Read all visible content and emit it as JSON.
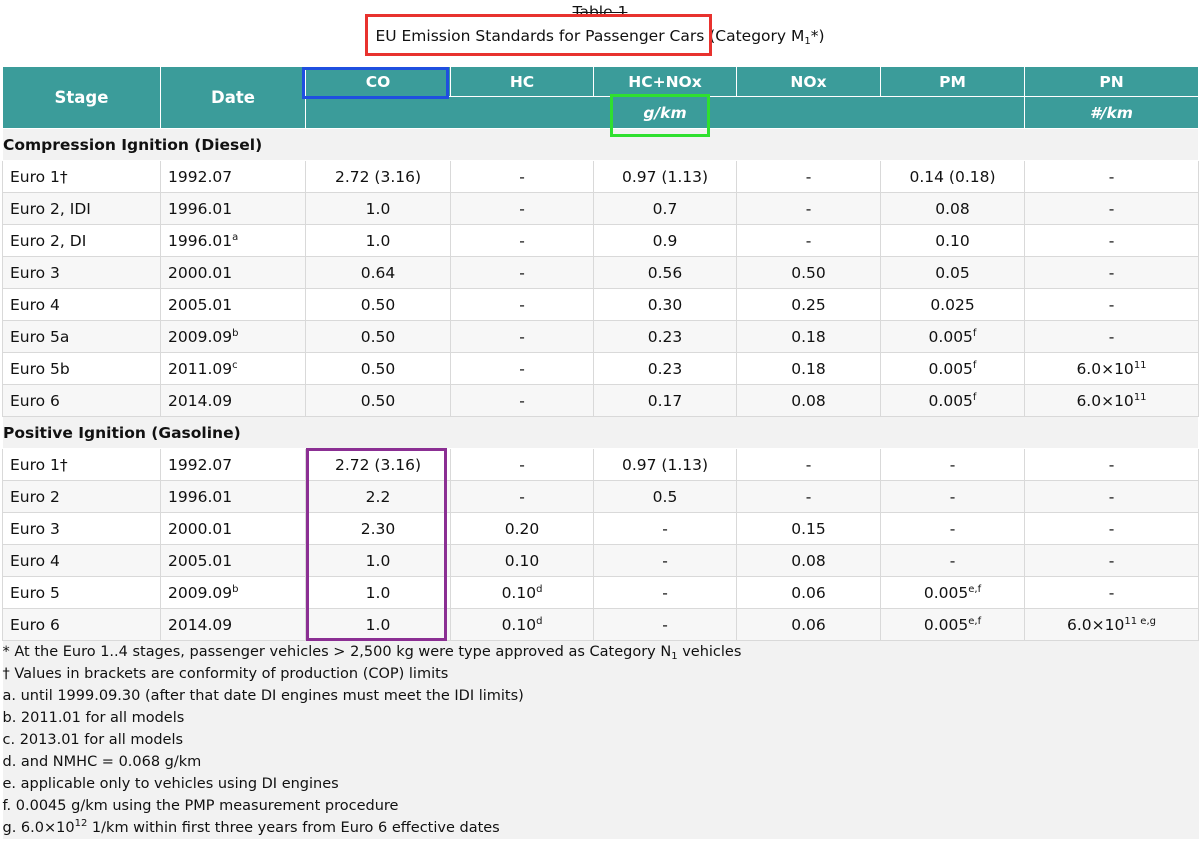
{
  "caption": {
    "label": "Table 1",
    "title_main": "EU Emission Standards for Passenger Cars",
    "title_pre_sub": " (Category M",
    "title_sub": "1",
    "title_post": "*)"
  },
  "headers": {
    "stage": "Stage",
    "date": "Date",
    "co": "CO",
    "hc": "HC",
    "hcnox": "HC+NOx",
    "nox": "NOx",
    "pm": "PM",
    "pn": "PN",
    "unit_gkm": "g/km",
    "unit_numkm": "#/km"
  },
  "sections": [
    {
      "title": "Compression Ignition (Diesel)",
      "rows": [
        [
          [
            "Euro 1†"
          ],
          [
            "1992.07"
          ],
          [
            "2.72 (3.16)"
          ],
          [
            "-"
          ],
          [
            "0.97 (1.13)"
          ],
          [
            "-"
          ],
          [
            "0.14 (0.18)"
          ],
          [
            "-"
          ]
        ],
        [
          [
            "Euro 2, IDI"
          ],
          [
            "1996.01"
          ],
          [
            "1.0"
          ],
          [
            "-"
          ],
          [
            "0.7"
          ],
          [
            "-"
          ],
          [
            "0.08"
          ],
          [
            "-"
          ]
        ],
        [
          [
            "Euro 2, DI"
          ],
          [
            "1996.01",
            "a"
          ],
          [
            "1.0"
          ],
          [
            "-"
          ],
          [
            "0.9"
          ],
          [
            "-"
          ],
          [
            "0.10"
          ],
          [
            "-"
          ]
        ],
        [
          [
            "Euro 3"
          ],
          [
            "2000.01"
          ],
          [
            "0.64"
          ],
          [
            "-"
          ],
          [
            "0.56"
          ],
          [
            "0.50"
          ],
          [
            "0.05"
          ],
          [
            "-"
          ]
        ],
        [
          [
            "Euro 4"
          ],
          [
            "2005.01"
          ],
          [
            "0.50"
          ],
          [
            "-"
          ],
          [
            "0.30"
          ],
          [
            "0.25"
          ],
          [
            "0.025"
          ],
          [
            "-"
          ]
        ],
        [
          [
            "Euro 5a"
          ],
          [
            "2009.09",
            "b"
          ],
          [
            "0.50"
          ],
          [
            "-"
          ],
          [
            "0.23"
          ],
          [
            "0.18"
          ],
          [
            "0.005",
            "f"
          ],
          [
            "-"
          ]
        ],
        [
          [
            "Euro 5b"
          ],
          [
            "2011.09",
            "c"
          ],
          [
            "0.50"
          ],
          [
            "-"
          ],
          [
            "0.23"
          ],
          [
            "0.18"
          ],
          [
            "0.005",
            "f"
          ],
          [
            "6.0×10",
            "11"
          ]
        ],
        [
          [
            "Euro 6"
          ],
          [
            "2014.09"
          ],
          [
            "0.50"
          ],
          [
            "-"
          ],
          [
            "0.17"
          ],
          [
            "0.08"
          ],
          [
            "0.005",
            "f"
          ],
          [
            "6.0×10",
            "11"
          ]
        ]
      ]
    },
    {
      "title": "Positive Ignition (Gasoline)",
      "rows": [
        [
          [
            "Euro 1†"
          ],
          [
            "1992.07"
          ],
          [
            "2.72 (3.16)"
          ],
          [
            "-"
          ],
          [
            "0.97 (1.13)"
          ],
          [
            "-"
          ],
          [
            "-"
          ],
          [
            "-"
          ]
        ],
        [
          [
            "Euro 2"
          ],
          [
            "1996.01"
          ],
          [
            "2.2"
          ],
          [
            "-"
          ],
          [
            "0.5"
          ],
          [
            "-"
          ],
          [
            "-"
          ],
          [
            "-"
          ]
        ],
        [
          [
            "Euro 3"
          ],
          [
            "2000.01"
          ],
          [
            "2.30"
          ],
          [
            "0.20"
          ],
          [
            "-"
          ],
          [
            "0.15"
          ],
          [
            "-"
          ],
          [
            "-"
          ]
        ],
        [
          [
            "Euro 4"
          ],
          [
            "2005.01"
          ],
          [
            "1.0"
          ],
          [
            "0.10"
          ],
          [
            "-"
          ],
          [
            "0.08"
          ],
          [
            "-"
          ],
          [
            "-"
          ]
        ],
        [
          [
            "Euro 5"
          ],
          [
            "2009.09",
            "b"
          ],
          [
            "1.0"
          ],
          [
            "0.10",
            "d"
          ],
          [
            "-"
          ],
          [
            "0.06"
          ],
          [
            "0.005",
            "e,f"
          ],
          [
            "-"
          ]
        ],
        [
          [
            "Euro 6"
          ],
          [
            "2014.09"
          ],
          [
            "1.0"
          ],
          [
            "0.10",
            "d"
          ],
          [
            "-"
          ],
          [
            "0.06"
          ],
          [
            "0.005",
            "e,f"
          ],
          [
            "6.0×10",
            "11 e,g"
          ]
        ]
      ]
    }
  ],
  "notes": {
    "n1_pre": "* At the Euro 1..4 stages, passenger vehicles > 2,500 kg were type approved as Category N",
    "n1_sub": "1",
    "n1_post": " vehicles",
    "n2": "† Values in brackets are conformity of production (COP) limits",
    "na": "a. until 1999.09.30 (after that date DI engines must meet the IDI limits)",
    "nb": "b. 2011.01 for all models",
    "nc": "c. 2013.01 for all models",
    "nd": "d. and NMHC = 0.068 g/km",
    "ne": "e. applicable only to vehicles using DI engines",
    "nf": "f. 0.0045 g/km using the PMP measurement procedure",
    "ng_pre": "g. 6.0×10",
    "ng_sup": "12",
    "ng_post": " 1/km within first three years from Euro 6 effective dates"
  },
  "colors": {
    "header_teal": "#3b9c9a",
    "highlight_red": "#e8322e",
    "highlight_blue": "#1f4fe0",
    "highlight_green": "#2fe02f",
    "highlight_purple": "#8b2f93"
  }
}
